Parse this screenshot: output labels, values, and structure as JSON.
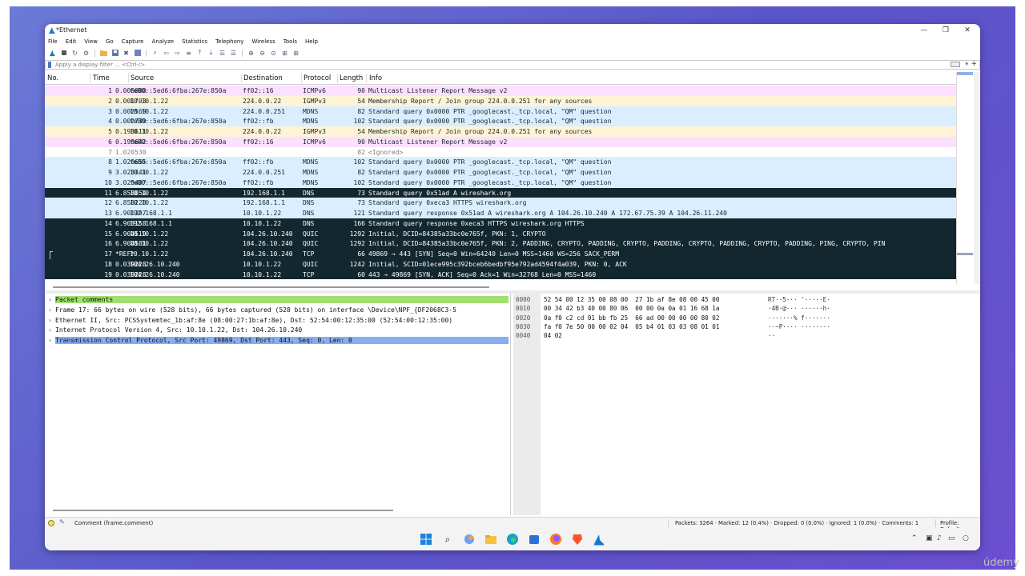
{
  "window": {
    "title": "*Ethernet",
    "controls": {
      "minimize": "—",
      "restore": "❐",
      "close": "✕"
    }
  },
  "menu": [
    "File",
    "Edit",
    "View",
    "Go",
    "Capture",
    "Analyze",
    "Statistics",
    "Telephony",
    "Wireless",
    "Tools",
    "Help"
  ],
  "toolbar": {
    "icons": [
      "shark-fin-icon",
      "stop-icon",
      "restart-icon",
      "options-gear-icon",
      "open-folder-icon",
      "save-icon",
      "close-file-icon",
      "reload-icon",
      "find-icon",
      "back-icon",
      "forward-icon",
      "go-to-packet-icon",
      "first-packet-icon",
      "last-packet-icon",
      "autoscroll-icon",
      "colorize-icon",
      "zoom-in-icon",
      "zoom-out-icon",
      "zoom-reset-icon",
      "resize-columns-icon",
      "layout-icon"
    ]
  },
  "filter": {
    "placeholder": "Apply a display filter ... <Ctrl-/>",
    "add_label": "+",
    "dropdown": "▾"
  },
  "packet_list": {
    "columns": [
      "No.",
      "Time",
      "Source",
      "Destination",
      "Protocol",
      "Length",
      "Info"
    ],
    "rows": [
      {
        "no": "1",
        "time": "0.000000",
        "src": "fe80::5ed6:6fba:267e:850a",
        "dst": "ff02::16",
        "proto": "ICMPv6",
        "len": "90",
        "info": "Multicast Listener Report Message v2",
        "bg": "#fce0ff",
        "fg": "#12272e"
      },
      {
        "no": "2",
        "time": "0.001703",
        "src": "10.10.1.22",
        "dst": "224.0.0.22",
        "proto": "IGMPv3",
        "len": "54",
        "info": "Membership Report / Join group 224.0.0.251 for any sources",
        "bg": "#fff3d6",
        "fg": "#12272e"
      },
      {
        "no": "3",
        "time": "0.002569",
        "src": "10.10.1.22",
        "dst": "224.0.0.251",
        "proto": "MDNS",
        "len": "82",
        "info": "Standard query 0x0000 PTR _googlecast._tcp.local, \"QM\" question",
        "bg": "#daeeff",
        "fg": "#12272e"
      },
      {
        "no": "4",
        "time": "0.002739",
        "src": "fe80::5ed6:6fba:267e:850a",
        "dst": "ff02::fb",
        "proto": "MDNS",
        "len": "102",
        "info": "Standard query 0x0000 PTR _googlecast._tcp.local, \"QM\" question",
        "bg": "#daeeff",
        "fg": "#12272e"
      },
      {
        "no": "5",
        "time": "0.193611",
        "src": "10.10.1.22",
        "dst": "224.0.0.22",
        "proto": "IGMPv3",
        "len": "54",
        "info": "Membership Report / Join group 224.0.0.251 for any sources",
        "bg": "#fff3d6",
        "fg": "#12272e"
      },
      {
        "no": "6",
        "time": "0.193642",
        "src": "fe80::5ed6:6fba:267e:850a",
        "dst": "ff02::16",
        "proto": "ICMPv6",
        "len": "90",
        "info": "Multicast Listener Report Message v2",
        "bg": "#fce0ff",
        "fg": "#12272e"
      },
      {
        "no": "7",
        "time": "1.020530",
        "src": "",
        "dst": "",
        "proto": "",
        "len": "82",
        "info": "<Ignored>",
        "bg": "#ffffff",
        "fg": "#7f7f7f"
      },
      {
        "no": "8",
        "time": "1.020655",
        "src": "fe80::5ed6:6fba:267e:850a",
        "dst": "ff02::fb",
        "proto": "MDNS",
        "len": "102",
        "info": "Standard query 0x0000 PTR _googlecast._tcp.local, \"QM\" question",
        "bg": "#daeeff",
        "fg": "#12272e"
      },
      {
        "no": "9",
        "time": "3.023341",
        "src": "10.10.1.22",
        "dst": "224.0.0.251",
        "proto": "MDNS",
        "len": "82",
        "info": "Standard query 0x0000 PTR _googlecast._tcp.local, \"QM\" question",
        "bg": "#daeeff",
        "fg": "#12272e"
      },
      {
        "no": "10",
        "time": "3.023407",
        "src": "fe80::5ed6:6fba:267e:850a",
        "dst": "ff02::fb",
        "proto": "MDNS",
        "len": "102",
        "info": "Standard query 0x0000 PTR _googlecast._tcp.local, \"QM\" question",
        "bg": "#daeeff",
        "fg": "#12272e"
      },
      {
        "no": "11",
        "time": "6.858054",
        "src": "10.10.1.22",
        "dst": "192.168.1.1",
        "proto": "DNS",
        "len": "73",
        "info": "Standard query 0x51ad A wireshark.org",
        "bg": "#12272e",
        "fg": "#ffffff"
      },
      {
        "no": "12",
        "time": "6.858228",
        "src": "10.10.1.22",
        "dst": "192.168.1.1",
        "proto": "DNS",
        "len": "73",
        "info": "Standard query 0xeca3 HTTPS wireshark.org",
        "bg": "#daeeff",
        "fg": "#12272e"
      },
      {
        "no": "13",
        "time": "6.901397",
        "src": "192.168.1.1",
        "dst": "10.10.1.22",
        "proto": "DNS",
        "len": "121",
        "info": "Standard query response 0x51ad A wireshark.org A 104.26.10.240 A 172.67.75.39 A 104.26.11.240",
        "bg": "#daeeff",
        "fg": "#12272e"
      },
      {
        "no": "14",
        "time": "6.903158",
        "src": "192.168.1.1",
        "dst": "10.10.1.22",
        "proto": "DNS",
        "len": "166",
        "info": "Standard query response 0xeca3 HTTPS wireshark.org HTTPS",
        "bg": "#12272e",
        "fg": "#ffffff"
      },
      {
        "no": "15",
        "time": "6.904519",
        "src": "10.10.1.22",
        "dst": "104.26.10.240",
        "proto": "QUIC",
        "len": "1292",
        "info": "Initial, DCID=84385a33bc0e765f, PKN: 1, CRYPTO",
        "bg": "#12272e",
        "fg": "#ffffff"
      },
      {
        "no": "16",
        "time": "6.904581",
        "src": "10.10.1.22",
        "dst": "104.26.10.240",
        "proto": "QUIC",
        "len": "1292",
        "info": "Initial, DCID=84385a33bc0e765f, PKN: 2, PADDING, CRYPTO, PADDING, CRYPTO, PADDING, CRYPTO, PADDING, CRYPTO, PADDING, PING, CRYPTO, PIN",
        "bg": "#12272e",
        "fg": "#ffffff"
      },
      {
        "no": "17",
        "time": "*REF*",
        "src": "10.10.1.22",
        "dst": "104.26.10.240",
        "proto": "TCP",
        "len": "66",
        "info": "49869 → 443 [SYN] Seq=0 Win=64240 Len=0 MSS=1460 WS=256 SACK_PERM",
        "bg": "#12272e",
        "fg": "#ffffff"
      },
      {
        "no": "18",
        "time": "0.039228",
        "src": "104.26.10.240",
        "dst": "10.10.1.22",
        "proto": "QUIC",
        "len": "1242",
        "info": "Initial, SCID=01ece995c392bceb6bedbf95e792ad4594f4a039, PKN: 0, ACK",
        "bg": "#12272e",
        "fg": "#ffffff"
      },
      {
        "no": "19",
        "time": "0.039228",
        "src": "104.26.10.240",
        "dst": "10.10.1.22",
        "proto": "TCP",
        "len": "60",
        "info": "443 → 49869 [SYN, ACK] Seq=0 Ack=1 Win=32768 Len=0 MSS=1460",
        "bg": "#12272e",
        "fg": "#ffffff"
      }
    ]
  },
  "details": {
    "rows": [
      {
        "text": "Packet comments",
        "bg": "#a0e070",
        "caret": "›"
      },
      {
        "text": "Frame 17: 66 bytes on wire (528 bits), 66 bytes captured (528 bits) on interface \\Device\\NPF_{DF2068C3-5",
        "bg": "#ffffff",
        "caret": "›"
      },
      {
        "text": "Ethernet II, Src: PCSSystemtec_1b:af:8e (08:00:27:1b:af:8e), Dst: 52:54:00:12:35:00 (52:54:00:12:35:00)",
        "bg": "#ffffff",
        "caret": "›"
      },
      {
        "text": "Internet Protocol Version 4, Src: 10.10.1.22, Dst: 104.26.10.240",
        "bg": "#ffffff",
        "caret": "›"
      },
      {
        "text": "Transmission Control Protocol, Src Port: 49869, Dst Port: 443, Seq: 0, Len: 0",
        "bg": "#86aef0",
        "caret": "›"
      }
    ]
  },
  "bytes": {
    "rows": [
      {
        "off": "0000",
        "hex": "52 54 00 12 35 00 08 00  27 1b af 8e 08 00 45 00",
        "ascii": "RT··5··· '·····E·"
      },
      {
        "off": "0010",
        "hex": "00 34 42 b3 40 00 80 06  00 00 0a 0a 01 16 68 1a",
        "ascii": "·4B·@··· ······h·"
      },
      {
        "off": "0020",
        "hex": "0a f0 c2 cd 01 bb fb 25  66 ad 00 00 00 00 80 02",
        "ascii": "·······% f·······"
      },
      {
        "off": "0030",
        "hex": "fa f0 7e 50 00 00 02 04  05 b4 01 03 03 08 01 01",
        "ascii": "··~P···· ········"
      },
      {
        "off": "0040",
        "hex": "04 02",
        "ascii": "··"
      }
    ]
  },
  "status": {
    "comment": "Comment (frame.comment)",
    "stats": "Packets: 3264 · Marked: 12 (0.4%) · Dropped: 0 (0.0%) · Ignored: 1 (0.0%) · Comments: 1",
    "profile": "Profile: Default"
  },
  "taskbar": {
    "apps": [
      "windows-start-icon",
      "search-icon",
      "copilot-icon",
      "file-explorer-icon",
      "edge-icon",
      "store-icon",
      "firefox-icon",
      "brave-icon",
      "wireshark-icon"
    ],
    "tray": [
      "chevron-up-icon",
      "network-icon",
      "volume-icon",
      "battery-icon",
      "notification-bell-icon"
    ]
  },
  "watermark": "údemy",
  "colors": {
    "accent": "#4973c9",
    "selected_row": "#86aef0",
    "comment_row": "#a0e070"
  }
}
